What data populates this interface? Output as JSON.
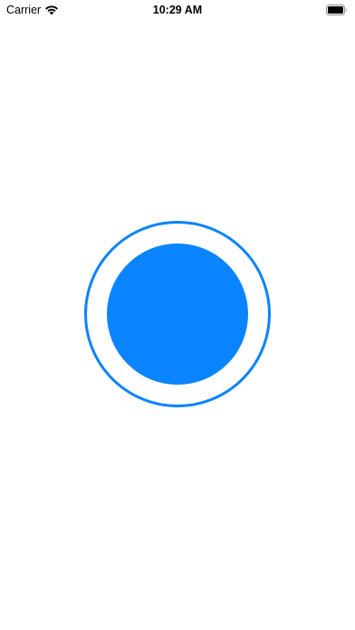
{
  "status_bar": {
    "carrier": "Carrier",
    "time": "10:29 AM",
    "icons": {
      "wifi": "wifi-icon",
      "battery": "battery-icon"
    }
  },
  "main": {
    "control": {
      "icon": "record-circle-icon",
      "color": "#0A84FF"
    }
  }
}
